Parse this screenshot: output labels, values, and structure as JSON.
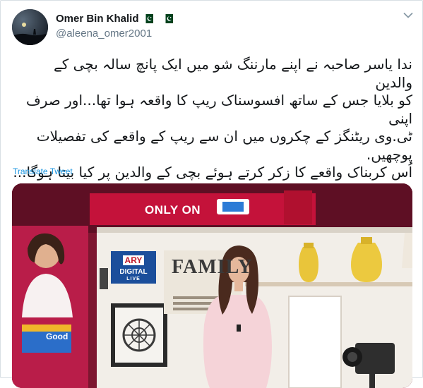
{
  "user": {
    "display_name": "Omer Bin Khalid",
    "handle": "@aleena_omer2001",
    "name_flags": [
      "pakistan-flag",
      "pakistan-flag"
    ]
  },
  "menu_icon": "chevron-down-icon",
  "tweet": {
    "lines": [
      "ندا یاسر صاحبہ نے اپنے مارننگ شو میں ایک پانچ سالہ بچی کے والدین",
      "کو بلایا جس کے ساتھ افسوسناک ریپ کا واقعہ ہوا تھا...اور صرف اپنی",
      "ٹی.وی ریٹنگز کے چکروں میں ان سے ریپ کے واقعے کی تفصیلات",
      "پوچھیں.",
      "اُس کربناک واقعے کا زکر کرتے ہوئے بچی کے والدین پر کیا بیتا ہوگا..."
    ],
    "translate_label": "Translate Tweet"
  },
  "media": {
    "banner_text": "ONLY ON",
    "channel_logo": {
      "line1": "ARY",
      "line2": "DIGITAL",
      "line3": "LIVE"
    },
    "wall_sign": "FAMILY",
    "show_logo": "Good",
    "colors": {
      "backdrop": "#7d1630",
      "banner": "#c4123a",
      "wall": "#f2eee8"
    }
  }
}
